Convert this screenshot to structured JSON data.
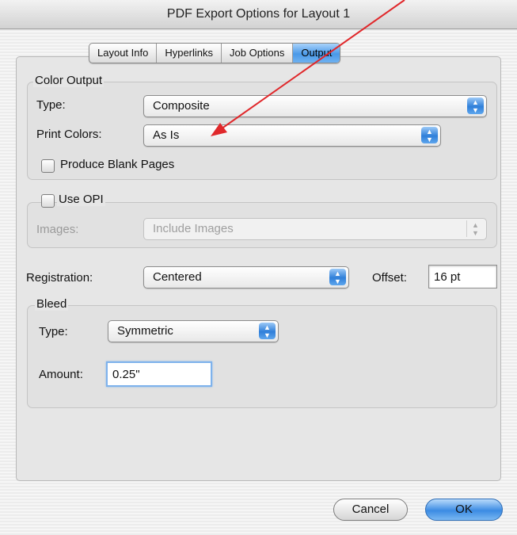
{
  "window": {
    "title": "PDF Export Options for Layout 1"
  },
  "tabs": [
    {
      "label": "Layout Info"
    },
    {
      "label": "Hyperlinks"
    },
    {
      "label": "Job Options"
    },
    {
      "label": "Output"
    }
  ],
  "color_output": {
    "group_title": "Color Output",
    "type_label": "Type:",
    "type_value": "Composite",
    "print_colors_label": "Print Colors:",
    "print_colors_value": "As Is",
    "blank_pages_label": "Produce Blank Pages"
  },
  "opi": {
    "label": "Use OPI",
    "images_label": "Images:",
    "images_value": "Include Images"
  },
  "registration": {
    "label": "Registration:",
    "value": "Centered",
    "offset_label": "Offset:",
    "offset_value": "16 pt"
  },
  "bleed": {
    "group_title": "Bleed",
    "type_label": "Type:",
    "type_value": "Symmetric",
    "amount_label": "Amount:",
    "amount_value": "0.25\""
  },
  "buttons": {
    "cancel": "Cancel",
    "ok": "OK"
  },
  "annotation": {
    "arrow_color": "#e0282b"
  }
}
